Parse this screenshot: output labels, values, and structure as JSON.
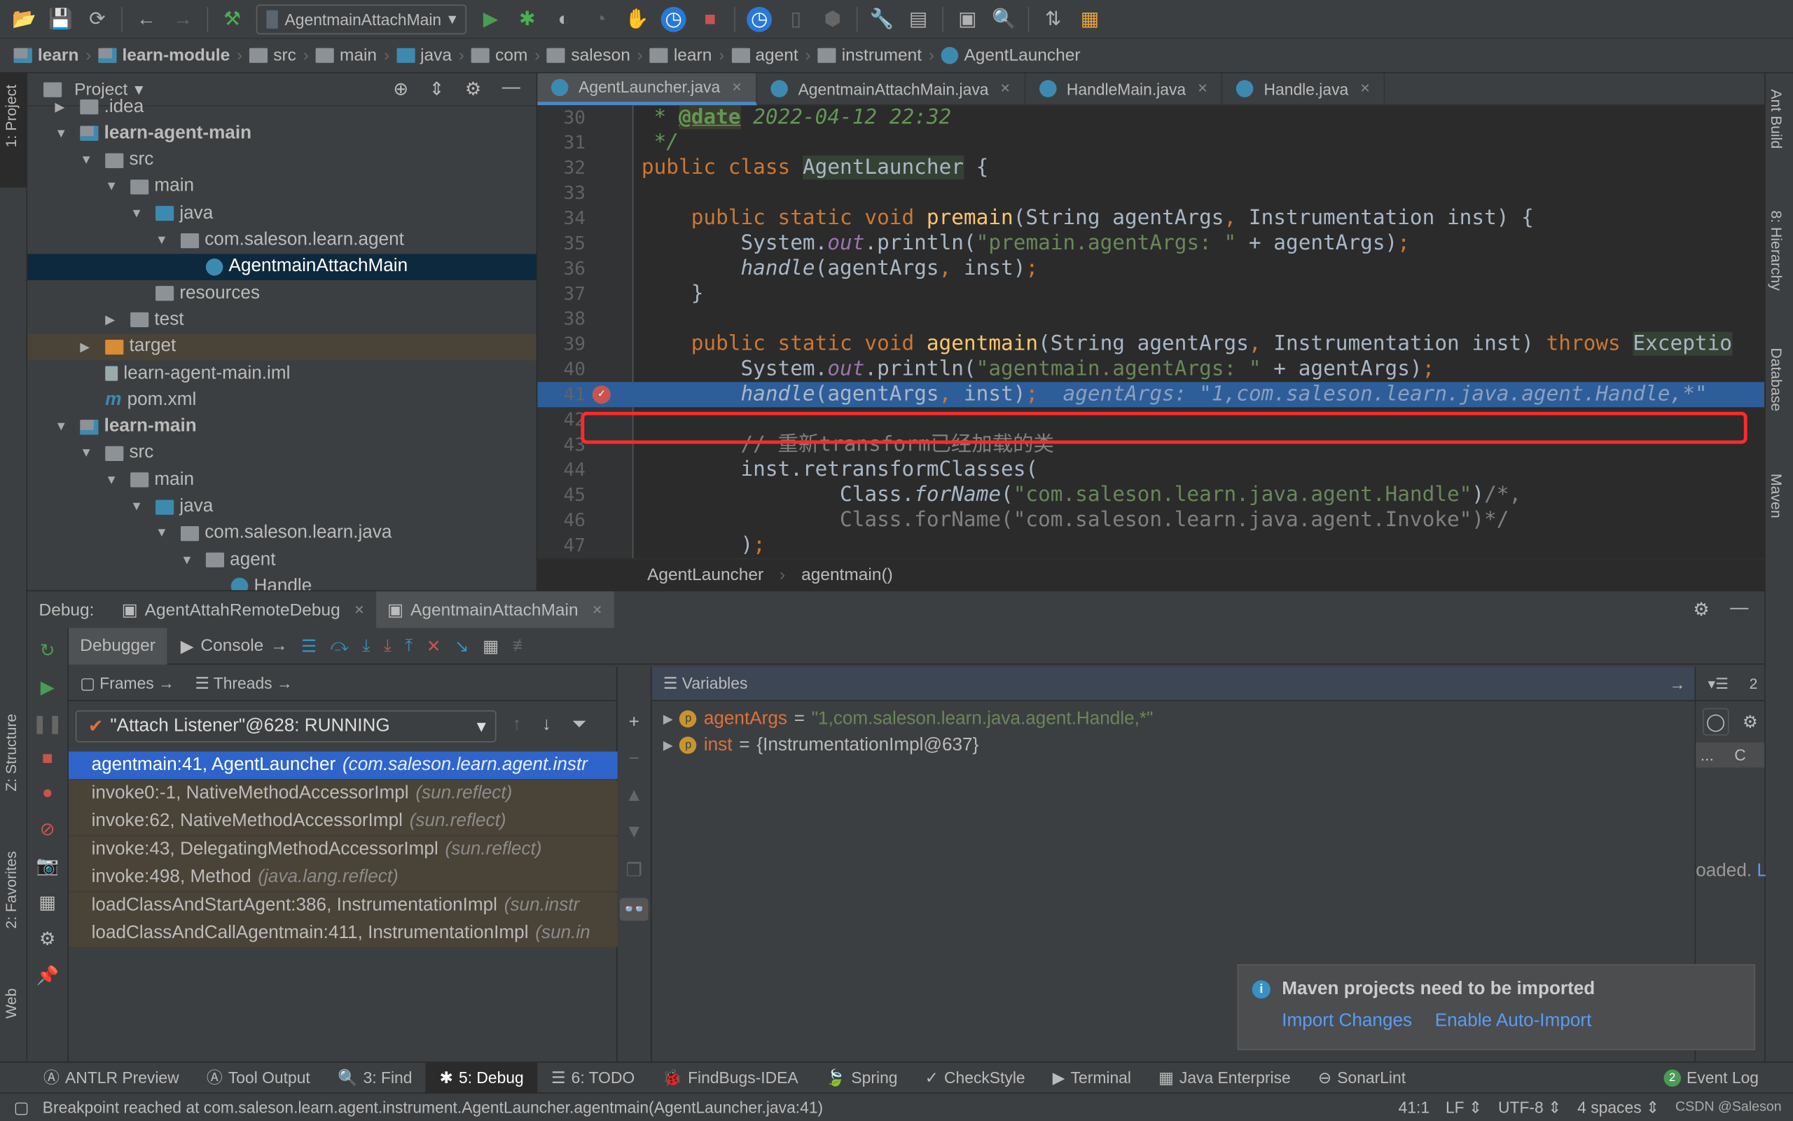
{
  "toolbar": {
    "run_config": "AgentmainAttachMain"
  },
  "breadcrumb": [
    {
      "label": "learn",
      "bold": true,
      "icon": "module"
    },
    {
      "label": "learn-module",
      "bold": true,
      "icon": "module"
    },
    {
      "label": "src",
      "icon": "folder"
    },
    {
      "label": "main",
      "icon": "folder"
    },
    {
      "label": "java",
      "icon": "folder-blue"
    },
    {
      "label": "com",
      "icon": "package"
    },
    {
      "label": "saleson",
      "icon": "package"
    },
    {
      "label": "learn",
      "icon": "package"
    },
    {
      "label": "agent",
      "icon": "package"
    },
    {
      "label": "instrument",
      "icon": "package"
    },
    {
      "label": "AgentLauncher",
      "icon": "class"
    }
  ],
  "left_stripe": {
    "project": "1: Project",
    "structure": "Z: Structure",
    "favorites": "2: Favorites",
    "web": "Web"
  },
  "right_stripe": {
    "ant": "Ant Build",
    "hierarchy": "8: Hierarchy",
    "database": "Database",
    "maven": "Maven"
  },
  "project": {
    "title": "Project",
    "tree": [
      {
        "label": ".idea",
        "depth": 1,
        "icon": "folder",
        "arrow": "right"
      },
      {
        "label": "learn-agent-main",
        "depth": 1,
        "icon": "module",
        "arrow": "down",
        "bold": true
      },
      {
        "label": "src",
        "depth": 2,
        "icon": "folder",
        "arrow": "down"
      },
      {
        "label": "main",
        "depth": 3,
        "icon": "folder",
        "arrow": "down"
      },
      {
        "label": "java",
        "depth": 4,
        "icon": "folder-blue",
        "arrow": "down"
      },
      {
        "label": "com.saleson.learn.agent",
        "depth": 5,
        "icon": "package",
        "arrow": "down"
      },
      {
        "label": "AgentmainAttachMain",
        "depth": 6,
        "icon": "class",
        "selected": true
      },
      {
        "label": "resources",
        "depth": 4,
        "icon": "folder"
      },
      {
        "label": "test",
        "depth": 3,
        "icon": "folder",
        "arrow": "right"
      },
      {
        "label": "target",
        "depth": 2,
        "icon": "folder-orange",
        "arrow": "right",
        "excluded": true
      },
      {
        "label": "learn-agent-main.iml",
        "depth": 2,
        "icon": "file"
      },
      {
        "label": "pom.xml",
        "depth": 2,
        "icon": "maven"
      },
      {
        "label": "learn-main",
        "depth": 1,
        "icon": "module",
        "arrow": "down",
        "bold": true
      },
      {
        "label": "src",
        "depth": 2,
        "icon": "folder",
        "arrow": "down"
      },
      {
        "label": "main",
        "depth": 3,
        "icon": "folder",
        "arrow": "down"
      },
      {
        "label": "java",
        "depth": 4,
        "icon": "folder-blue",
        "arrow": "down"
      },
      {
        "label": "com.saleson.learn.java",
        "depth": 5,
        "icon": "package",
        "arrow": "down"
      },
      {
        "label": "agent",
        "depth": 6,
        "icon": "package",
        "arrow": "down"
      },
      {
        "label": "Handle",
        "depth": 7,
        "icon": "class"
      }
    ]
  },
  "editor": {
    "tabs": [
      {
        "label": "AgentLauncher.java",
        "active": true
      },
      {
        "label": "AgentmainAttachMain.java"
      },
      {
        "label": "HandleMain.java"
      },
      {
        "label": "Handle.java"
      }
    ],
    "current_line": 41,
    "lines": [
      {
        "n": 30,
        "t": [
          [
            " * ",
            "doc"
          ],
          [
            "@date",
            "tag"
          ],
          [
            " 2022-04-12 22:32",
            "doc"
          ]
        ]
      },
      {
        "n": 31,
        "t": [
          [
            " */",
            "doc"
          ]
        ]
      },
      {
        "n": 32,
        "t": [
          [
            "public class ",
            "kw"
          ],
          [
            "AgentLauncher",
            "hl"
          ],
          [
            " {",
            ""
          ]
        ]
      },
      {
        "n": 33,
        "t": []
      },
      {
        "n": 34,
        "t": [
          [
            "    public static void ",
            "kw"
          ],
          [
            "premain",
            "fn"
          ],
          [
            "(String agentArgs",
            ""
          ],
          [
            ", ",
            "kw"
          ],
          [
            "Instrumentation inst) {",
            ""
          ]
        ]
      },
      {
        "n": 35,
        "t": [
          [
            "        System.",
            ""
          ],
          [
            "out",
            "field"
          ],
          [
            ".println(",
            ""
          ],
          [
            "\"premain.agentArgs: \"",
            "str"
          ],
          [
            " + agentArgs)",
            ""
          ],
          [
            ";",
            "kw"
          ]
        ]
      },
      {
        "n": 36,
        "t": [
          [
            "        ",
            ""
          ],
          [
            "handle",
            "it"
          ],
          [
            "(agentArgs",
            ""
          ],
          [
            ", ",
            "kw"
          ],
          [
            "inst)",
            ""
          ],
          [
            ";",
            "kw"
          ]
        ]
      },
      {
        "n": 37,
        "t": [
          [
            "    }",
            ""
          ]
        ]
      },
      {
        "n": 38,
        "t": []
      },
      {
        "n": 39,
        "t": [
          [
            "    public static void ",
            "kw"
          ],
          [
            "agentmain",
            "fn"
          ],
          [
            "(String agentArgs",
            ""
          ],
          [
            ", ",
            "kw"
          ],
          [
            "Instrumentation inst) ",
            ""
          ],
          [
            "throws ",
            "kw"
          ],
          [
            "Exceptio",
            "hl"
          ]
        ]
      },
      {
        "n": 40,
        "t": [
          [
            "        System.",
            ""
          ],
          [
            "out",
            "field"
          ],
          [
            ".println(",
            ""
          ],
          [
            "\"agentmain.agentArgs: \"",
            "str"
          ],
          [
            " + agentArgs)",
            ""
          ],
          [
            ";",
            "kw"
          ]
        ]
      },
      {
        "n": 41,
        "t": [
          [
            "        ",
            ""
          ],
          [
            "handle",
            "it"
          ],
          [
            "(agentArgs",
            ""
          ],
          [
            ", ",
            "kw"
          ],
          [
            "inst)",
            ""
          ],
          [
            ";",
            "kw"
          ],
          [
            "  agentArgs: \"1,com.saleson.learn.java.agent.Handle,*\"",
            "inl"
          ]
        ]
      },
      {
        "n": 42,
        "t": []
      },
      {
        "n": 43,
        "t": [
          [
            "        // 重新transform已经加载的类",
            "cmt"
          ]
        ]
      },
      {
        "n": 44,
        "t": [
          [
            "        inst.retransformClasses(",
            ""
          ]
        ]
      },
      {
        "n": 45,
        "t": [
          [
            "                Class.",
            ""
          ],
          [
            "forName",
            "it"
          ],
          [
            "(",
            ""
          ],
          [
            "\"com.saleson.learn.java.agent.Handle\"",
            "str"
          ],
          [
            ")",
            ""
          ],
          [
            "/*,",
            "cmt"
          ]
        ]
      },
      {
        "n": 46,
        "t": [
          [
            "                Class.forName(\"com.saleson.learn.java.agent.Invoke\")*/",
            "cmt"
          ]
        ]
      },
      {
        "n": 47,
        "t": [
          [
            "        )",
            ""
          ],
          [
            ";",
            "kw"
          ]
        ]
      }
    ],
    "crumb": [
      "AgentLauncher",
      "agentmain()"
    ]
  },
  "debug": {
    "label": "Debug:",
    "tabs": [
      {
        "label": "AgentAttahRemoteDebug"
      },
      {
        "label": "AgentmainAttachMain",
        "active": true
      }
    ],
    "debugger_tab": "Debugger",
    "console_tab": "Console",
    "frames_label": "Frames",
    "threads_label": "Threads",
    "thread": "\"Attach Listener\"@628: RUNNING",
    "frames": [
      {
        "method": "agentmain:41, AgentLauncher",
        "pkg": "(com.saleson.learn.agent.instr",
        "selected": true
      },
      {
        "method": "invoke0:-1, NativeMethodAccessorImpl",
        "pkg": "(sun.reflect)"
      },
      {
        "method": "invoke:62, NativeMethodAccessorImpl",
        "pkg": "(sun.reflect)"
      },
      {
        "method": "invoke:43, DelegatingMethodAccessorImpl",
        "pkg": "(sun.reflect)"
      },
      {
        "method": "invoke:498, Method",
        "pkg": "(java.lang.reflect)"
      },
      {
        "method": "loadClassAndStartAgent:386, InstrumentationImpl",
        "pkg": "(sun.instr"
      },
      {
        "method": "loadClassAndCallAgentmain:411, InstrumentationImpl",
        "pkg": "(sun.in"
      }
    ],
    "variables_label": "Variables",
    "variables": [
      {
        "name": "agentArgs",
        "value": "\"1,com.saleson.learn.java.agent.Handle,*\"",
        "string": true
      },
      {
        "name": "inst",
        "value": "{InstrumentationImpl@637}"
      }
    ],
    "overhead_count": "2",
    "side_col": "C",
    "side_dots": "...",
    "side_text": "oaded.",
    "side_link": "L"
  },
  "notification": {
    "title": "Maven projects need to be imported",
    "import": "Import Changes",
    "auto": "Enable Auto-Import"
  },
  "tool_windows": [
    {
      "label": "ANTLR Preview"
    },
    {
      "label": "Tool Output"
    },
    {
      "label": "3: Find"
    },
    {
      "label": "5: Debug",
      "active": true
    },
    {
      "label": "6: TODO"
    },
    {
      "label": "FindBugs-IDEA"
    },
    {
      "label": "Spring"
    },
    {
      "label": "CheckStyle"
    },
    {
      "label": "Terminal"
    },
    {
      "label": "Java Enterprise"
    },
    {
      "label": "SonarLint"
    }
  ],
  "event_log": {
    "label": "Event Log",
    "count": "2"
  },
  "status": {
    "message": "Breakpoint reached at com.saleson.learn.agent.instrument.AgentLauncher.agentmain(AgentLauncher.java:41)",
    "position": "41:1",
    "line_sep": "LF",
    "encoding": "UTF-8",
    "indent": "4 spaces",
    "watermark": "CSDN @Saleson"
  },
  "colors": {
    "accent": "#2f65ca",
    "breakpoint_box": "#ff2a2a",
    "current_line": "#2d5e9a",
    "link": "#589df6"
  }
}
